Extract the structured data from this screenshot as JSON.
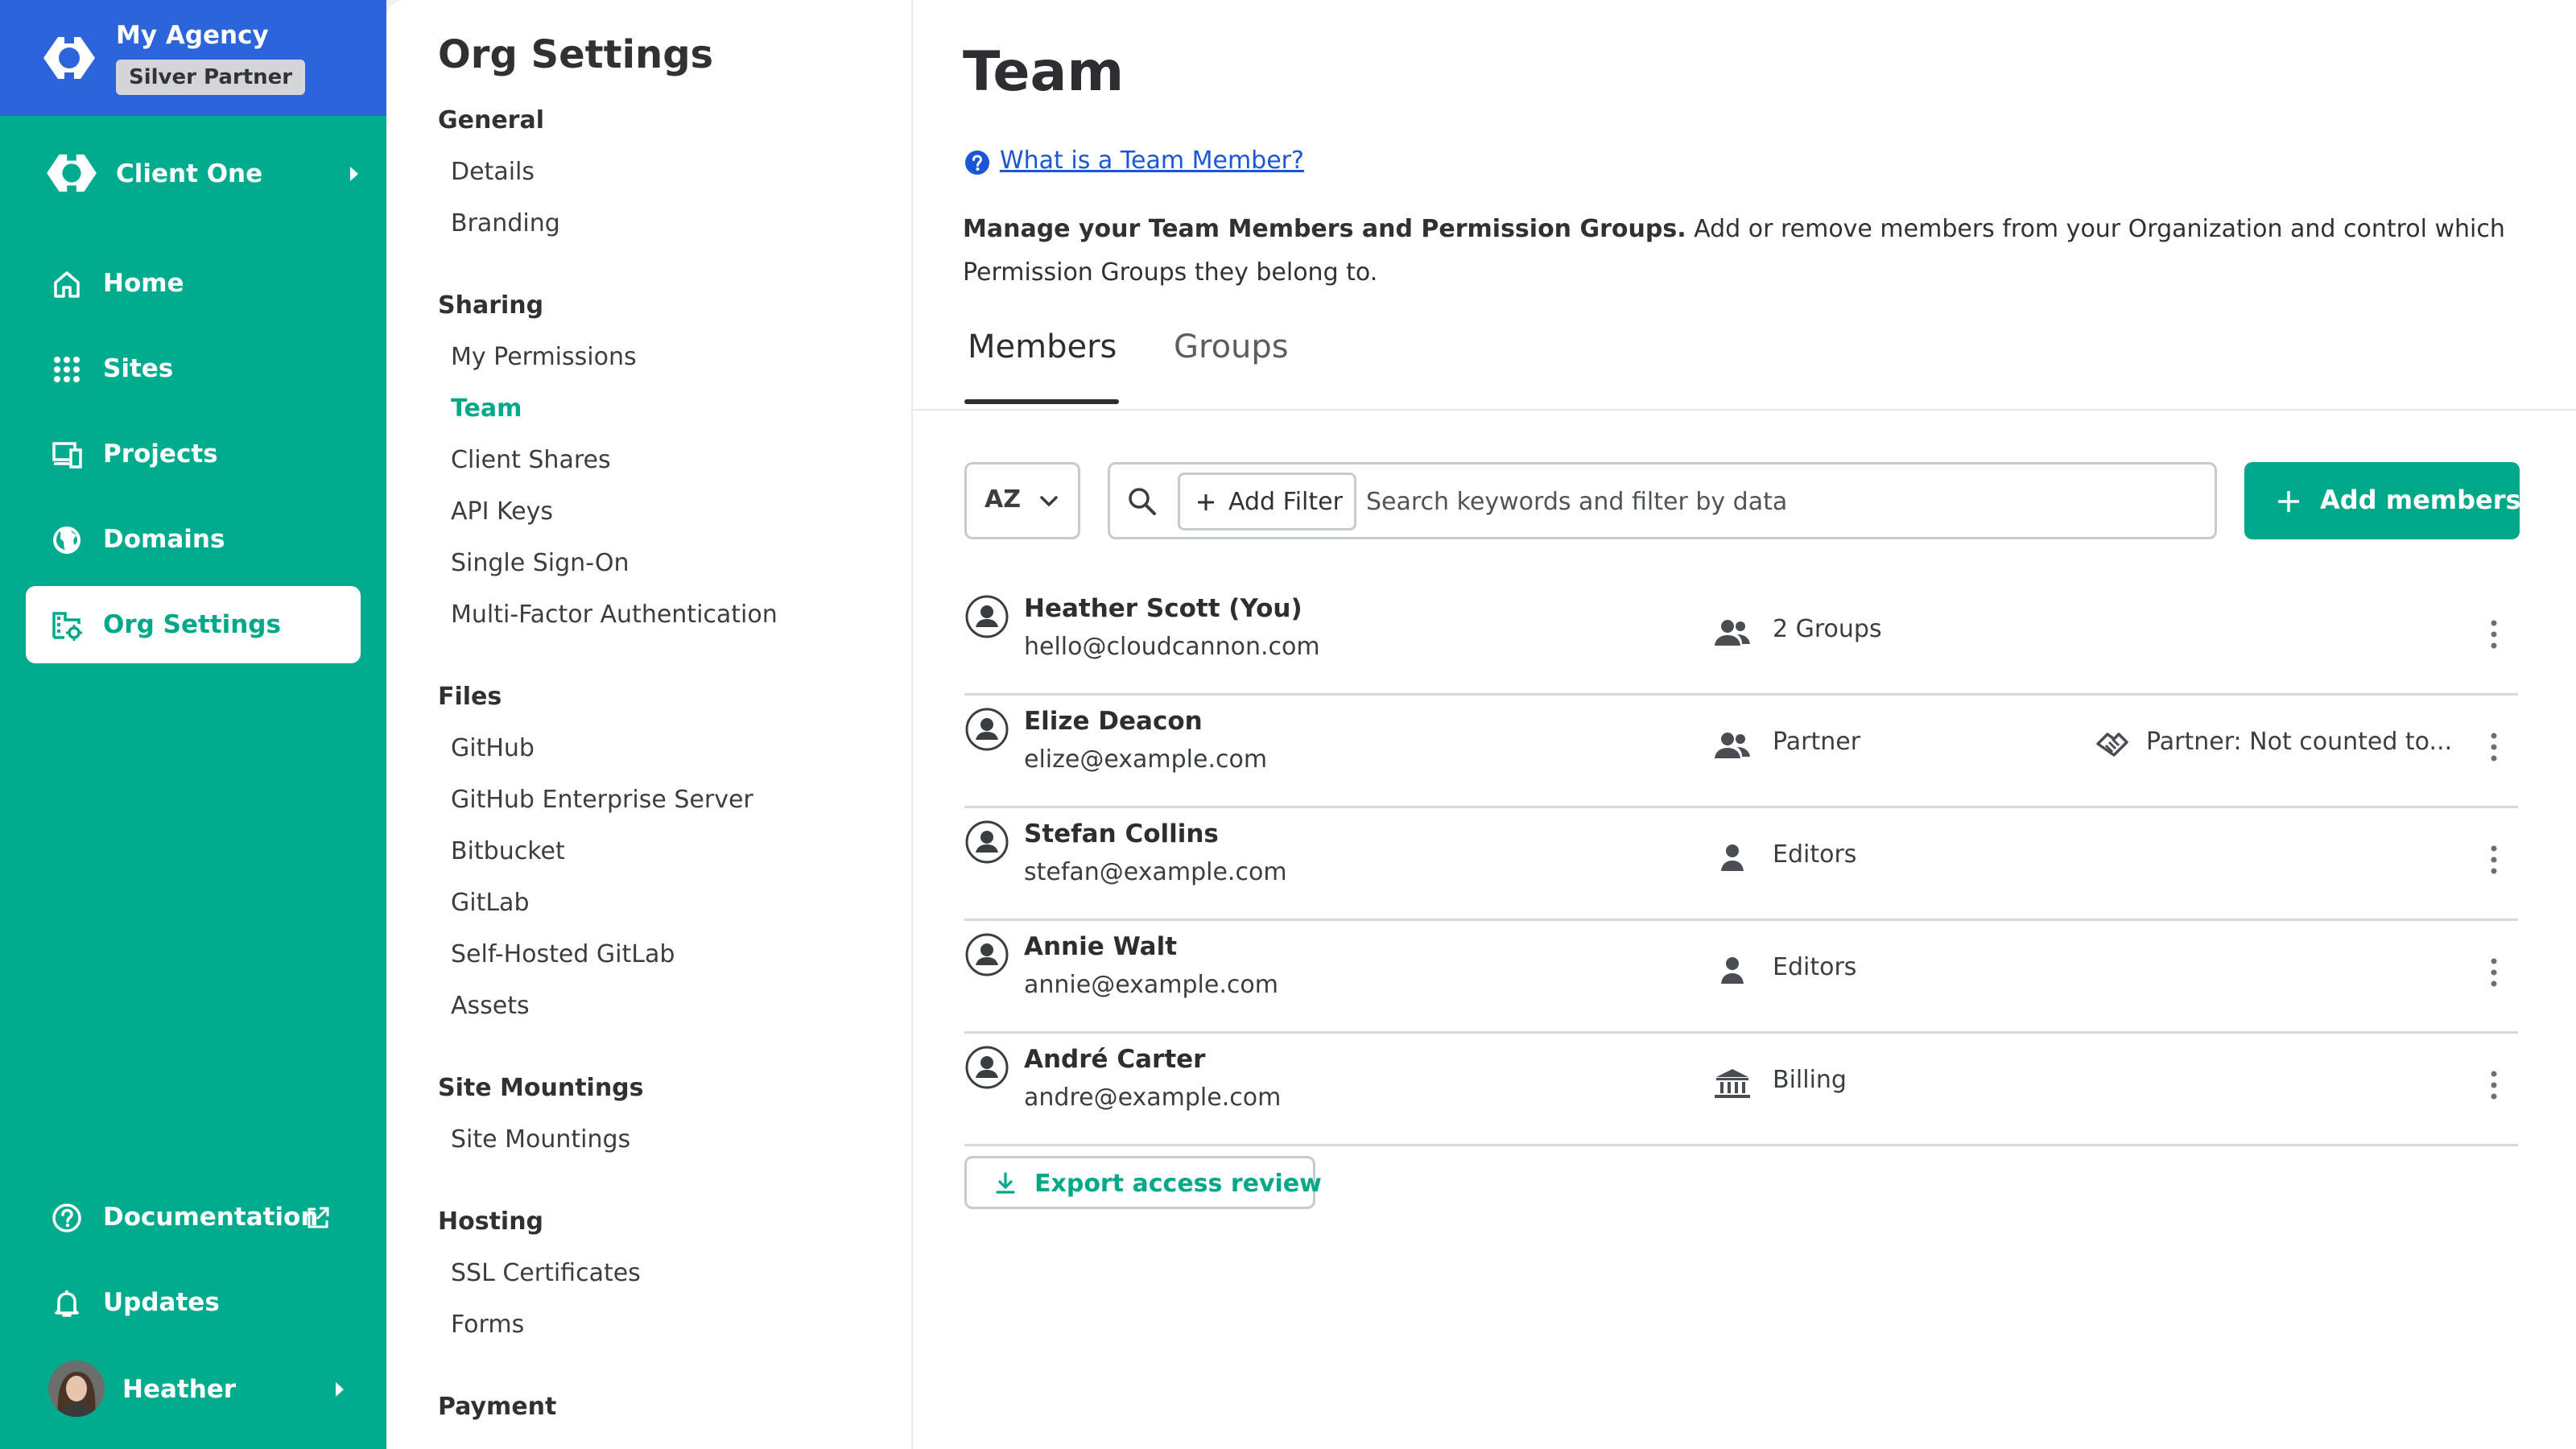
{
  "colors": {
    "brand_green": "#00ab8e",
    "agency_blue": "#2c64db",
    "link_blue": "#1b56d6",
    "active_teal": "#00a88a"
  },
  "agency": {
    "name": "My Agency",
    "badge": "Silver Partner"
  },
  "client": {
    "name": "Client One"
  },
  "nav": {
    "home": "Home",
    "sites": "Sites",
    "projects": "Projects",
    "domains": "Domains",
    "org_settings": "Org Settings",
    "documentation": "Documentation",
    "updates": "Updates"
  },
  "user": {
    "name": "Heather"
  },
  "settings": {
    "title": "Org Settings",
    "sections": [
      {
        "heading": "General",
        "links": [
          "Details",
          "Branding"
        ]
      },
      {
        "heading": "Sharing",
        "links": [
          "My Permissions",
          "Team",
          "Client Shares",
          "API Keys",
          "Single Sign-On",
          "Multi-Factor Authentication"
        ]
      },
      {
        "heading": "Files",
        "links": [
          "GitHub",
          "GitHub Enterprise Server",
          "Bitbucket",
          "GitLab",
          "Self-Hosted GitLab",
          "Assets"
        ]
      },
      {
        "heading": "Site Mountings",
        "links": [
          "Site Mountings"
        ]
      },
      {
        "heading": "Hosting",
        "links": [
          "SSL Certificates",
          "Forms"
        ]
      },
      {
        "heading": "Payment",
        "links": []
      }
    ],
    "active_link": "Team"
  },
  "page": {
    "title": "Team",
    "help_link": "What is a Team Member?",
    "description_bold": "Manage your Team Members and Permission Groups.",
    "description_rest": " Add or remove members from your Organization and control which Permission Groups they belong to.",
    "tabs": [
      {
        "label": "Members",
        "active": true
      },
      {
        "label": "Groups",
        "active": false
      }
    ]
  },
  "toolbar": {
    "sort_label": "AZ",
    "add_filter_label": "Add Filter",
    "search_placeholder": "Search keywords and filter by data",
    "search_value": "",
    "add_members_label": "Add members"
  },
  "members": [
    {
      "name": "Heather Scott (You)",
      "email": "hello@cloudcannon.com",
      "group_icon": "group-icon",
      "group": "2 Groups",
      "extra": ""
    },
    {
      "name": "Elize Deacon",
      "email": "elize@example.com",
      "group_icon": "group-icon",
      "group": "Partner",
      "extra_icon": "handshake-icon",
      "extra": "Partner: Not counted to..."
    },
    {
      "name": "Stefan Collins",
      "email": "stefan@example.com",
      "group_icon": "person-icon",
      "group": "Editors",
      "extra": ""
    },
    {
      "name": "Annie Walt",
      "email": "annie@example.com",
      "group_icon": "person-icon",
      "group": "Editors",
      "extra": ""
    },
    {
      "name": "André Carter",
      "email": "andre@example.com",
      "group_icon": "bank-icon",
      "group": "Billing",
      "extra": ""
    }
  ],
  "export": {
    "label": "Export access review"
  }
}
